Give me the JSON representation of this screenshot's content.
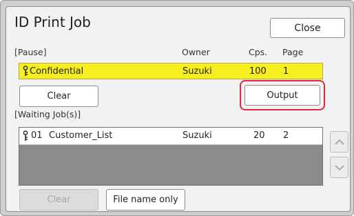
{
  "dialog": {
    "title": "ID Print Job",
    "close_label": "Close"
  },
  "paused": {
    "section_label": "[Pause]",
    "columns": {
      "owner": "Owner",
      "copies": "Cps.",
      "page": "Page"
    },
    "jobs": [
      {
        "name": "Confidential",
        "owner": "Suzuki",
        "copies": "100",
        "page": "1",
        "selected": true
      }
    ],
    "clear_label": "Clear",
    "output_label": "Output"
  },
  "waiting": {
    "section_label": "[Waiting Job(s)]",
    "jobs": [
      {
        "number": "01",
        "name": "Customer_List",
        "owner": "Suzuki",
        "copies": "20",
        "page": "2"
      }
    ],
    "clear_label": "Clear",
    "file_name_only_label": "File name only"
  },
  "icons": {
    "job": "lock-job-icon",
    "scroll_up": "chevron-up-icon",
    "scroll_down": "chevron-down-icon"
  },
  "colors": {
    "selected_row": "#f6ee1f",
    "output_highlight": "#e2253a"
  }
}
